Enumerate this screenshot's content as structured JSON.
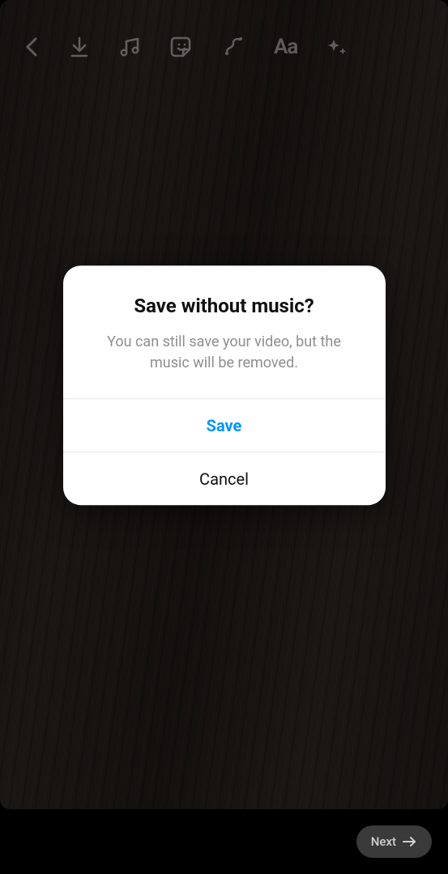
{
  "toolbar": {
    "text_icon_label": "Aa"
  },
  "dialog": {
    "title": "Save without music?",
    "message": "You can still save your video, but the music will be removed.",
    "primary": "Save",
    "secondary": "Cancel"
  },
  "bottom": {
    "next": "Next"
  }
}
